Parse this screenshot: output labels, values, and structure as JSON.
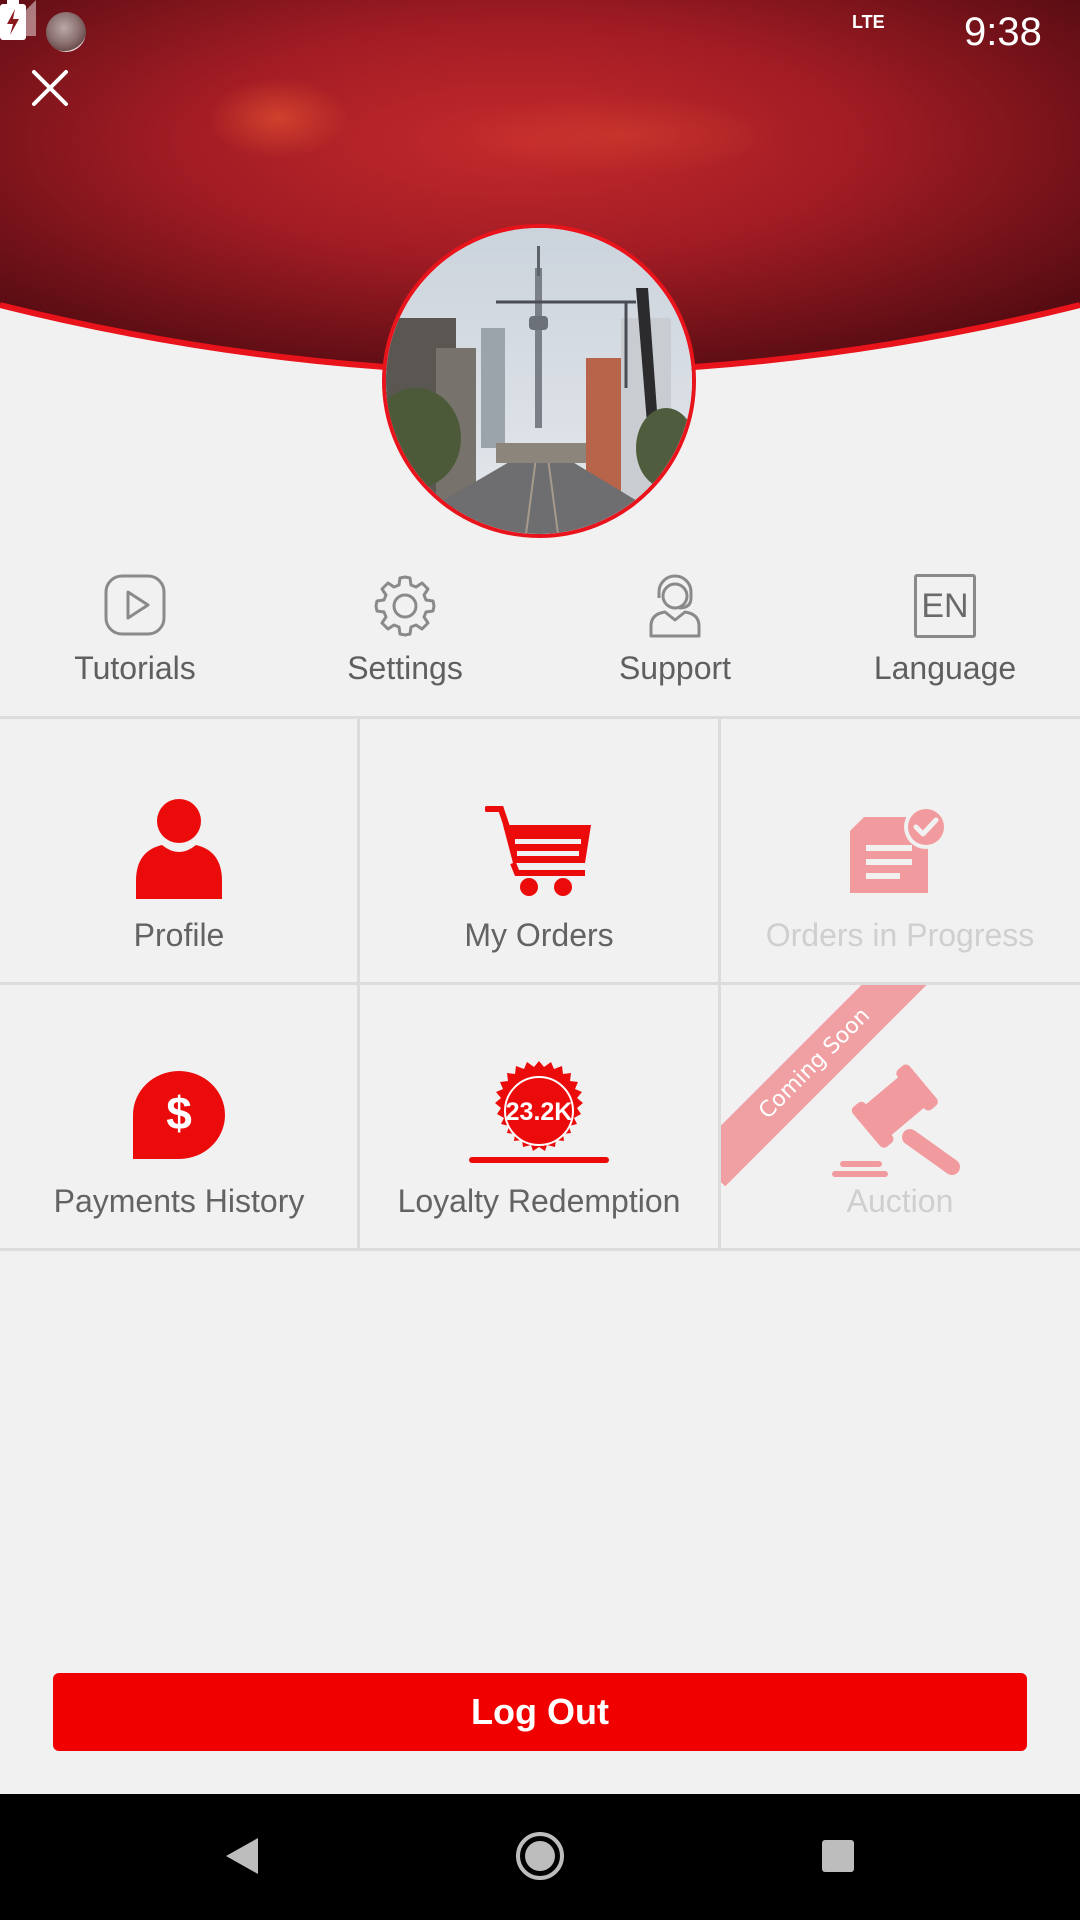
{
  "status_bar": {
    "network": "LTE",
    "time": "9:38"
  },
  "quick_actions": [
    {
      "label": "Tutorials",
      "icon": "play-circle-icon"
    },
    {
      "label": "Settings",
      "icon": "gear-icon"
    },
    {
      "label": "Support",
      "icon": "headset-person-icon"
    },
    {
      "label": "Language",
      "icon": "language-en-icon",
      "badge": "EN"
    }
  ],
  "menu": [
    {
      "label": "Profile",
      "icon": "person-icon",
      "enabled": true
    },
    {
      "label": "My Orders",
      "icon": "cart-icon",
      "enabled": true
    },
    {
      "label": "Orders in Progress",
      "icon": "order-check-icon",
      "enabled": false
    },
    {
      "label": "Payments History",
      "icon": "dollar-bubble-icon",
      "enabled": true
    },
    {
      "label": "Loyalty Redemption",
      "icon": "loyalty-badge-icon",
      "badge_value": "23.2K",
      "enabled": true
    },
    {
      "label": "Auction",
      "icon": "gavel-icon",
      "enabled": false,
      "ribbon": "Coming Soon"
    }
  ],
  "logout_label": "Log Out",
  "colors": {
    "accent": "#f10000",
    "header_dark": "#5a0d12",
    "header_mid": "#b0222a",
    "background": "#f2f1f1",
    "disabled_icon": "#f19b9e"
  }
}
